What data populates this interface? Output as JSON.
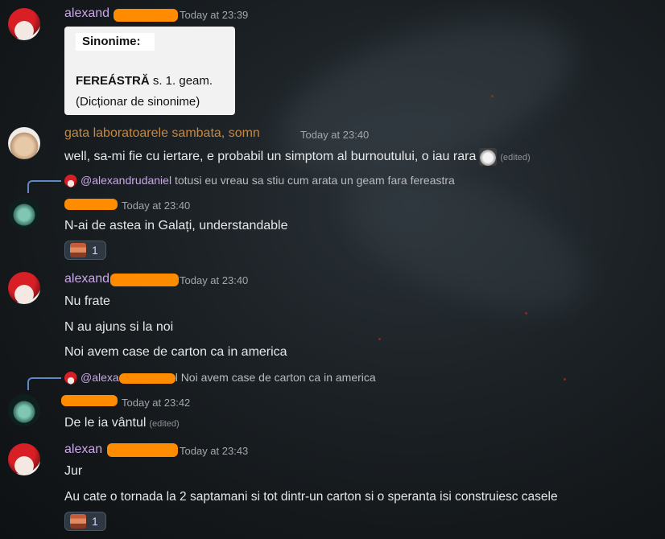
{
  "colors": {
    "username_purple": "#c9a8e6",
    "username_orange": "#c9883a",
    "redaction": "#ff8c00",
    "reply_line": "#5d88c4"
  },
  "messages": [
    {
      "username": "alexand",
      "timestamp": "Today at 23:39",
      "avatar": "red-hair-avatar",
      "embed": {
        "title": "Sinonime:",
        "headword": "FEREÁSTRĂ",
        "definition": " s. 1. geam.",
        "source": "(Dicționar de sinonime)"
      }
    },
    {
      "username": "gata laboratoarele sambata, somn",
      "timestamp": "Today at 23:40",
      "avatar": "cat-avatar",
      "lines": [
        "well, sa-mi fie cu iertare, e probabil un simptom al burnoutului, o iau rara"
      ],
      "edited": "(edited)"
    },
    {
      "reply": {
        "mention": "@alexandrudaniel",
        "text": " totusi eu vreau sa stiu cum arata un geam fara fereastra"
      },
      "username": "",
      "timestamp": "Today at 23:40",
      "avatar": "green-creature-avatar",
      "lines": [
        "N-ai de astea in Galați, understandable"
      ],
      "reaction_count": "1"
    },
    {
      "username": "alexand",
      "timestamp": "Today at 23:40",
      "avatar": "red-hair-avatar",
      "lines": [
        "Nu frate",
        "N au ajuns si la noi",
        "Noi avem case de carton ca in america"
      ]
    },
    {
      "reply": {
        "mention": "@alexa",
        "text": "l Noi avem case de carton ca in america"
      },
      "username": "",
      "timestamp": "Today at 23:42",
      "avatar": "green-creature-avatar",
      "lines": [
        "De le ia vântul"
      ],
      "edited": "(edited)"
    },
    {
      "username": "alexan",
      "timestamp": "Today at 23:43",
      "avatar": "red-hair-avatar",
      "lines": [
        "Jur",
        "Au cate o tornada la 2 saptamani si tot dintr-un carton si o speranta isi construiesc casele"
      ],
      "reaction_count": "1"
    }
  ]
}
